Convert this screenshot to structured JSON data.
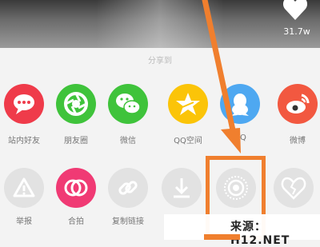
{
  "video": {
    "like_count": "31.7w"
  },
  "share": {
    "title": "分享到",
    "row1": [
      {
        "label": "站内好友",
        "icon": "chat-bubble-icon",
        "color": "#ef3b4a"
      },
      {
        "label": "朋友圈",
        "icon": "aperture-icon",
        "color": "#3fc33b"
      },
      {
        "label": "微信",
        "icon": "wechat-icon",
        "color": "#3fc33b"
      },
      {
        "label": "QQ空间",
        "icon": "qzone-star-icon",
        "color": "#fbc408"
      },
      {
        "label": "QQ",
        "icon": "qq-penguin-icon",
        "color": "#4ea8f1"
      },
      {
        "label": "微博",
        "icon": "weibo-icon",
        "color": "#f25840"
      }
    ],
    "row2": [
      {
        "label": "举报",
        "icon": "warning-icon"
      },
      {
        "label": "合拍",
        "icon": "duet-icon",
        "color": "#f03a74"
      },
      {
        "label": "复制链接",
        "icon": "link-icon"
      },
      {
        "label": "",
        "icon": "download-icon"
      },
      {
        "label": "",
        "icon": "live-photo-icon"
      },
      {
        "label": "",
        "icon": "broken-heart-icon"
      }
    ]
  },
  "annotation": {
    "color": "#f07f2e"
  },
  "watermark": {
    "text": "来源：H12.NET"
  }
}
